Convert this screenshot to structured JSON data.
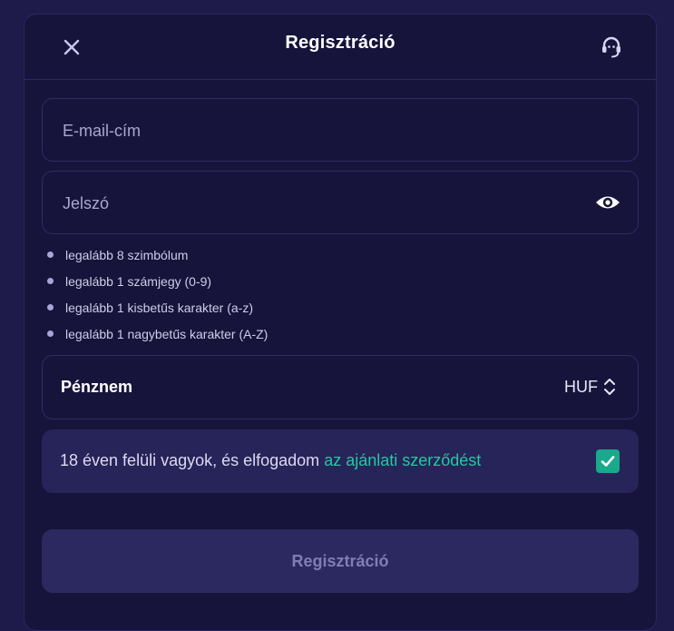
{
  "modal": {
    "title": "Regisztráció",
    "close_icon": "close-icon",
    "support_icon": "headset-support-icon"
  },
  "form": {
    "email": {
      "placeholder": "E-mail-cím",
      "value": ""
    },
    "password": {
      "placeholder": "Jelszó",
      "value": "",
      "toggle_icon": "eye-icon"
    },
    "password_rules": [
      "legalább 8 szimbólum",
      "legalább 1 számjegy (0-9)",
      "legalább 1 kisbetűs karakter (a-z)",
      "legalább 1 nagybetűs karakter (A-Z)"
    ],
    "currency": {
      "label": "Pénznem",
      "value": "HUF",
      "icon": "chevron-up-down-icon"
    },
    "consent": {
      "text": "18 éven felüli vagyok, és elfogadom ",
      "link_text": "az ajánlati szerződést",
      "checked": true,
      "check_icon": "check-icon"
    },
    "submit_label": "Regisztráció"
  },
  "colors": {
    "background": "#1e1a4a",
    "modal_bg": "#16143a",
    "accent": "#22c9a2",
    "checkbox": "#1aa98a",
    "button_disabled_bg": "#2c2961"
  }
}
